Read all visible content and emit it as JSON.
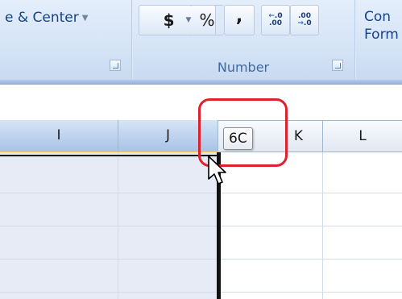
{
  "ribbon": {
    "alignment_group": {
      "merge_center_label": "e & Center",
      "merge_center_arrow": "▼"
    },
    "number_group": {
      "label": "Number",
      "currency_symbol": "$",
      "dropdown_arrow": "▼",
      "percent_symbol": "%",
      "comma_symbol": ",",
      "increase_decimal": {
        "line1": ".0",
        "line2": ".00"
      },
      "decrease_decimal": {
        "line1": ".00",
        "line2": ".0"
      }
    },
    "styles_group": {
      "conditional_format_line1": "Con",
      "conditional_format_line2": "Form"
    }
  },
  "sheet": {
    "columns": [
      {
        "name": "I",
        "selected": true
      },
      {
        "name": "J",
        "selected": true
      },
      {
        "name": "K",
        "selected": false
      },
      {
        "name": "L",
        "selected": false
      }
    ],
    "column_width_tooltip": "6C"
  },
  "colors": {
    "selection_fill": "#e7ebf5",
    "annotation": "#e0202c",
    "ribbon_text": "#15428b"
  }
}
